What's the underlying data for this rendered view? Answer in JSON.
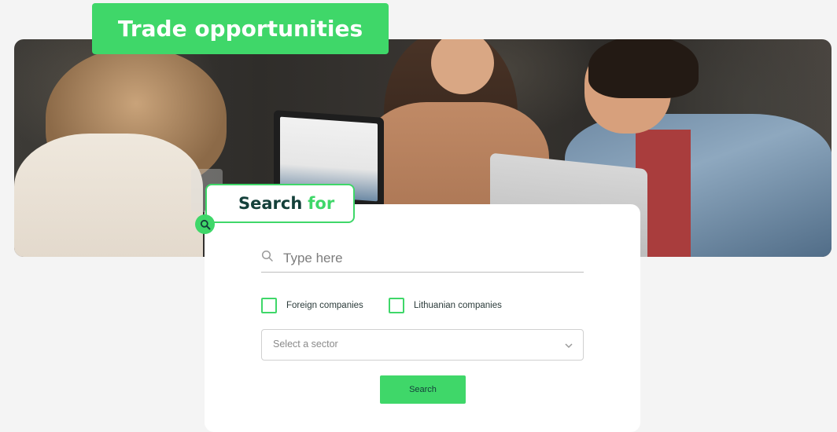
{
  "header": {
    "title": "Trade opportunities"
  },
  "search_tab": {
    "label_main": "Search",
    "label_accent": "for",
    "icon": "search-icon"
  },
  "search": {
    "placeholder": "Type here",
    "value": ""
  },
  "filters": {
    "checkboxes": [
      {
        "label": "Foreign companies",
        "checked": false
      },
      {
        "label": "Lithuanian companies",
        "checked": false
      }
    ],
    "sector_select": {
      "selected": "Select a sector",
      "icon": "chevron-down-icon"
    }
  },
  "actions": {
    "search_label": "Search"
  },
  "colors": {
    "accent": "#3fd769",
    "dark_text": "#14403a",
    "background": "#f4f4f4"
  }
}
